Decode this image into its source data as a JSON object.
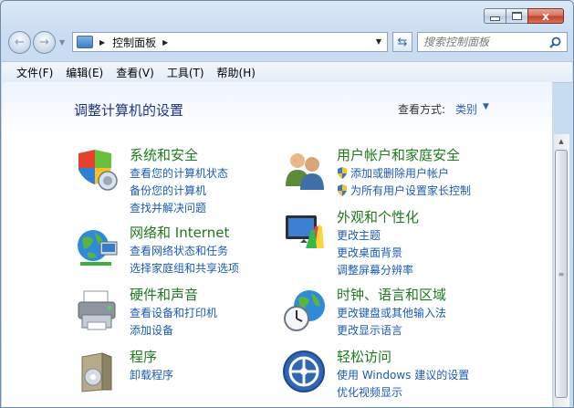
{
  "window": {
    "caption_close": "x"
  },
  "nav": {
    "back_glyph": "←",
    "forward_glyph": "→",
    "address": "控制面板",
    "refresh_glyph": "⇆",
    "search_placeholder": "搜索控制面板"
  },
  "menu": [
    "文件(F)",
    "编辑(E)",
    "查看(V)",
    "工具(T)",
    "帮助(H)"
  ],
  "header": {
    "title": "调整计算机的设置",
    "view_by_label": "查看方式:",
    "view_by_value": "类别"
  },
  "categories": [
    {
      "icon": "security-shield-icon",
      "title": "系统和安全",
      "links": [
        "查看您的计算机状态",
        "备份您的计算机",
        "查找并解决问题"
      ]
    },
    {
      "icon": "network-globe-icon",
      "title": "网络和 Internet",
      "links": [
        "查看网络状态和任务",
        "选择家庭组和共享选项"
      ]
    },
    {
      "icon": "printer-icon",
      "title": "硬件和声音",
      "links": [
        "查看设备和打印机",
        "添加设备"
      ]
    },
    {
      "icon": "programs-box-icon",
      "title": "程序",
      "links": [
        "卸载程序"
      ]
    },
    {
      "icon": "user-accounts-icon",
      "title": "用户帐户和家庭安全",
      "links": [
        "添加或删除用户帐户",
        "为所有用户设置家长控制"
      ],
      "shield_links": [
        true,
        true
      ]
    },
    {
      "icon": "appearance-monitor-icon",
      "title": "外观和个性化",
      "links": [
        "更改主题",
        "更改桌面背景",
        "调整屏幕分辨率"
      ]
    },
    {
      "icon": "clock-globe-icon",
      "title": "时钟、语言和区域",
      "links": [
        "更改键盘或其他输入法",
        "更改显示语言"
      ]
    },
    {
      "icon": "ease-of-access-icon",
      "title": "轻松访问",
      "links": [
        "使用 Windows 建议的设置",
        "优化视频显示"
      ]
    }
  ],
  "colors": {
    "category_title": "#1d7a1d",
    "link": "#1a5bb8",
    "page_title": "#1e3287"
  }
}
